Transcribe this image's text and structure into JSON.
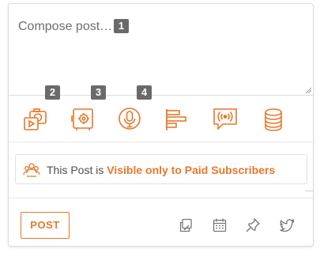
{
  "composer": {
    "placeholder": "Compose post…"
  },
  "badges": [
    "1",
    "2",
    "3",
    "4"
  ],
  "toolbar": {
    "tools": [
      {
        "icon": "camera-photo-video-icon"
      },
      {
        "icon": "settings-box-icon"
      },
      {
        "icon": "microphone-icon"
      },
      {
        "icon": "bar-chart-poll-icon"
      },
      {
        "icon": "live-broadcast-icon"
      },
      {
        "icon": "coins-stack-icon"
      }
    ]
  },
  "visibility": {
    "prefix": "This Post is ",
    "value": "Visible only to Paid Subscribers",
    "icon": "users-group-icon"
  },
  "footer": {
    "post_label": "POST",
    "icons": [
      "copy-icon",
      "calendar-icon",
      "pin-icon",
      "twitter-icon"
    ]
  },
  "colors": {
    "accent": "#e8772b",
    "badge_bg": "#6a6a6a",
    "text": "#4d4d4d",
    "icon_gray": "#777777"
  }
}
